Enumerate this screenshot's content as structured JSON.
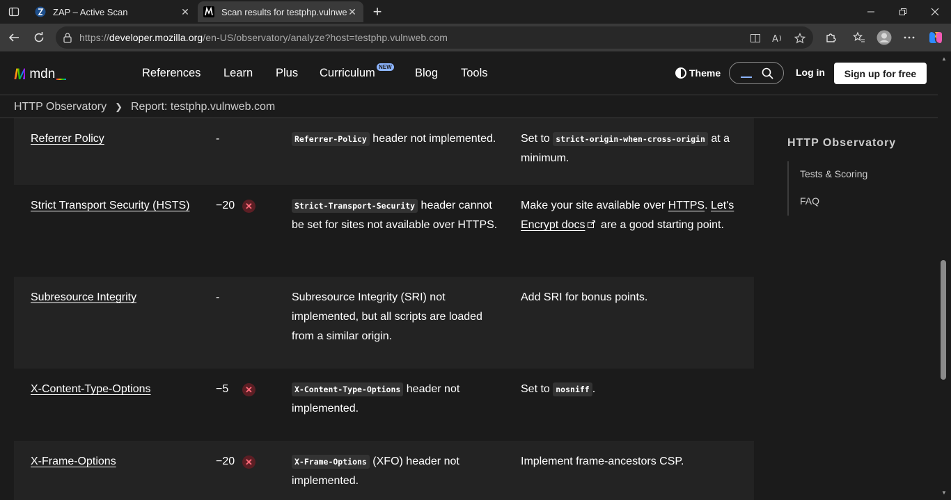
{
  "browser": {
    "tabs": [
      {
        "title": "ZAP – Active Scan",
        "active": false
      },
      {
        "title": "Scan results for testphp.vulnweb.com",
        "active": true
      }
    ],
    "url": {
      "prefix": "https://",
      "host": "developer.mozilla.org",
      "path": "/en-US/observatory/analyze?host=testphp.vulnweb.com"
    }
  },
  "mdn": {
    "logo_text": "mdn",
    "nav": [
      "References",
      "Learn",
      "Plus",
      "Curriculum",
      "Blog",
      "Tools"
    ],
    "new_badge": "NEW",
    "theme_label": "Theme",
    "login_label": "Log in",
    "signup_label": "Sign up for free"
  },
  "breadcrumbs": [
    "HTTP Observatory",
    "Report: testphp.vulnweb.com"
  ],
  "results": [
    {
      "test": "Referrer Policy",
      "score": "-",
      "failed": false,
      "reason": {
        "code": "Referrer-Policy",
        "text": " header not implemented."
      },
      "advice": {
        "before": "Set to ",
        "code": "strict-origin-when-cross-origin",
        "after": " at a minimum."
      }
    },
    {
      "test": "Strict Transport Security (HSTS)",
      "score": "−20",
      "failed": true,
      "reason": {
        "code": "Strict-Transport-Security",
        "text": " header cannot be set for sites not available over HTTPS."
      },
      "advice": {
        "before": "Make your site available over ",
        "link1": "HTTPS",
        "mid": ". ",
        "link2": "Let's Encrypt docs",
        "after": " are a good starting point."
      }
    },
    {
      "test": "Subresource Integrity",
      "score": "-",
      "failed": false,
      "reason": {
        "text": "Subresource Integrity (SRI) not implemented, but all scripts are loaded from a similar origin."
      },
      "advice": {
        "text": "Add SRI for bonus points."
      }
    },
    {
      "test": "X-Content-Type-Options",
      "score": "−5",
      "failed": true,
      "reason": {
        "code": "X-Content-Type-Options",
        "text": " header not implemented."
      },
      "advice": {
        "before": "Set to ",
        "code": "nosniff",
        "after": "."
      }
    },
    {
      "test": "X-Frame-Options",
      "score": "−20",
      "failed": true,
      "reason": {
        "code": "X-Frame-Options",
        "text": " (XFO) header not implemented."
      },
      "advice": {
        "text": "Implement frame-ancestors CSP."
      }
    }
  ],
  "toc": {
    "title": "HTTP Observatory",
    "items": [
      "Tests & Scoring",
      "FAQ"
    ]
  },
  "icons": {
    "fail": "x-circle-icon",
    "external": "external-link-icon"
  },
  "colors": {
    "page_bg": "#1b1b1b",
    "row_alt": "#232323",
    "fail_red": "#ff6b7a"
  }
}
